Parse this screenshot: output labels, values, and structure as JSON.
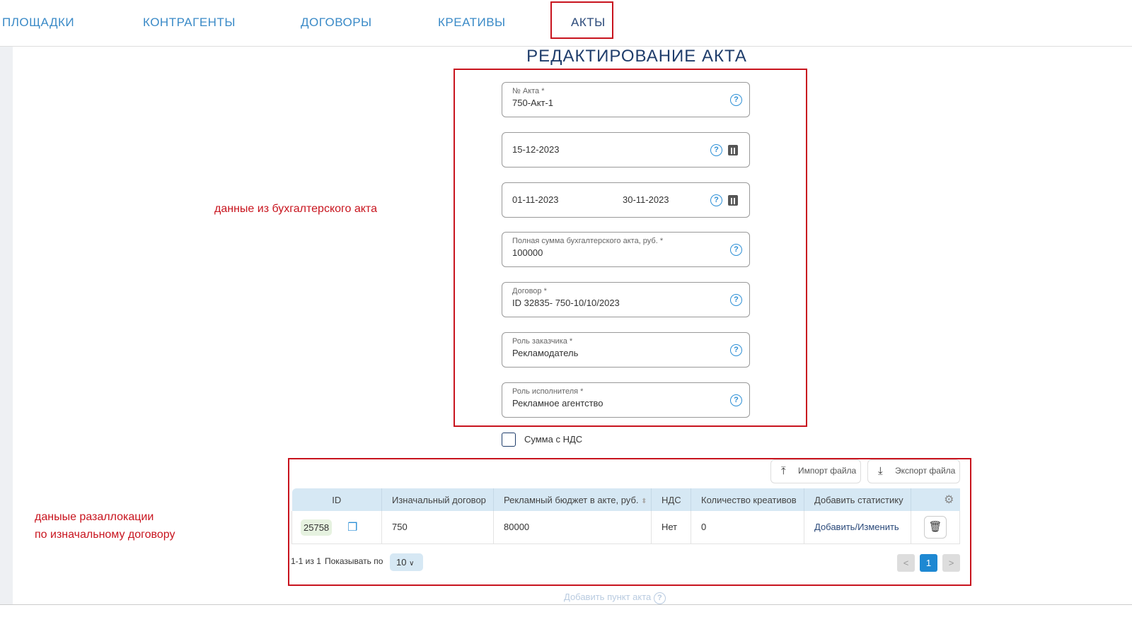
{
  "nav": {
    "items": [
      "ПЛОЩАДКИ",
      "КОНТРАГЕНТЫ",
      "ДОГОВОРЫ",
      "КРЕАТИВЫ",
      "АКТЫ"
    ],
    "active": "АКТЫ"
  },
  "title": "РЕДАКТИРОВАНИЕ АКТА",
  "form": {
    "act_number": {
      "label": "№ Акта *",
      "value": "750-Акт-1"
    },
    "act_date": {
      "value": "15-12-2023"
    },
    "period": {
      "from": "01-11-2023",
      "to": "30-11-2023"
    },
    "total_sum": {
      "label": "Полная сумма бухгалтерского акта, руб. *",
      "value": "100000"
    },
    "contract": {
      "label": "Договор *",
      "value": "ID 32835- 750-10/10/2023"
    },
    "customer_role": {
      "label": "Роль заказчика *",
      "value": "Рекламодатель"
    },
    "executor_role": {
      "label": "Роль исполнителя *",
      "value": "Рекламное агентство"
    },
    "vat_checkbox": {
      "label": "Сумма с НДС",
      "checked": false
    }
  },
  "notes": {
    "accounting": "данные из бухгалтерского акта",
    "realloc_1": "даныые разаллокации",
    "realloc_2": "по изначальному договору"
  },
  "table": {
    "import_label": "Импорт файла",
    "export_label": "Экспорт файла",
    "columns": [
      "ID",
      "Изначальный договор",
      "Рекламный бюджет в акте, руб.",
      "НДС",
      "Количество креативов",
      "Добавить статистику"
    ],
    "rows": [
      {
        "id": "25758",
        "contract": "750",
        "budget": "80000",
        "vat": "Нет",
        "creatives": "0",
        "stats": "Добавить/Изменить"
      }
    ],
    "range": "1-1 из 1",
    "show_by_label": "Показывать по",
    "page_size": "10",
    "current_page": "1"
  },
  "add_item": "Добавить пункт акта",
  "icons": {
    "q": "?",
    "prev": "<",
    "next": ">"
  }
}
